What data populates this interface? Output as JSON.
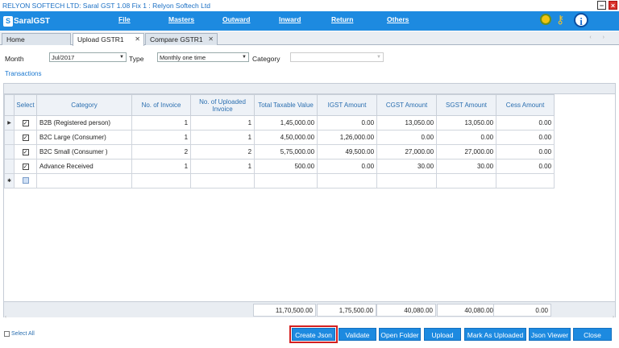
{
  "window": {
    "title": "RELYON SOFTECH LTD: Saral GST  1.08 Fix 1 : Relyon Softech Ltd"
  },
  "app": {
    "logo_mark": "S",
    "logo_text": "SaralGST"
  },
  "menu": [
    "File",
    "Masters",
    "Outward",
    "Inward",
    "Return",
    "Others"
  ],
  "tabs": [
    {
      "label": "Home"
    },
    {
      "label": "Upload GSTR1"
    },
    {
      "label": "Compare GSTR1"
    }
  ],
  "filters": {
    "month_label": "Month",
    "month_value": "Jul/2017",
    "type_label": "Type",
    "type_value": "Monthly one time",
    "category_label": "Category",
    "category_value": ""
  },
  "section_title": "Transactions",
  "table": {
    "columns": [
      "Select",
      "Category",
      "No. of Invoice",
      "No. of Uploaded Invoice",
      "Total Taxable Value",
      "IGST Amount",
      "CGST Amount",
      "SGST Amount",
      "Cess Amount"
    ],
    "rows": [
      {
        "category": "B2B (Registered person)",
        "invoices": "1",
        "uploaded": "1",
        "taxable": "1,45,000.00",
        "igst": "0.00",
        "cgst": "13,050.00",
        "sgst": "13,050.00",
        "cess": "0.00"
      },
      {
        "category": "B2C Large (Consumer)",
        "invoices": "1",
        "uploaded": "1",
        "taxable": "4,50,000.00",
        "igst": "1,26,000.00",
        "cgst": "0.00",
        "sgst": "0.00",
        "cess": "0.00"
      },
      {
        "category": "B2C Small (Consumer )",
        "invoices": "2",
        "uploaded": "2",
        "taxable": "5,75,000.00",
        "igst": "49,500.00",
        "cgst": "27,000.00",
        "sgst": "27,000.00",
        "cess": "0.00"
      },
      {
        "category": "Advance Received",
        "invoices": "1",
        "uploaded": "1",
        "taxable": "500.00",
        "igst": "0.00",
        "cgst": "30.00",
        "sgst": "30.00",
        "cess": "0.00"
      }
    ],
    "totals": {
      "taxable": "11,70,500.00",
      "igst": "1,75,500.00",
      "cgst": "40,080.00",
      "sgst": "40,080.00",
      "cess": "0.00"
    }
  },
  "footer": {
    "select_all": "Select All",
    "buttons": [
      "Create Json",
      "Validate",
      "Open Folder",
      "Upload",
      "Mark As Uploaded",
      "Json Viewer",
      "Close"
    ]
  },
  "colors": {
    "accent": "#1d8ae0",
    "highlight": "#d42020"
  },
  "icons": [
    "gear-icon",
    "key-icon",
    "info-icon"
  ]
}
